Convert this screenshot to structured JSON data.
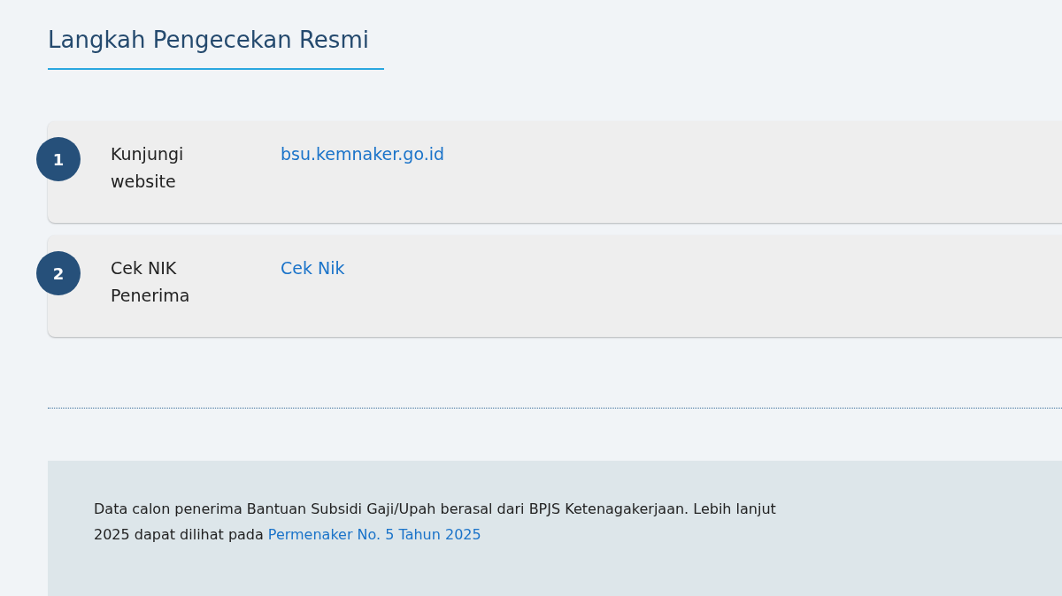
{
  "heading": "Langkah Pengecekan Resmi",
  "steps": [
    {
      "number": "1",
      "label": "Kunjungi website",
      "link": "bsu.kemnaker.go.id"
    },
    {
      "number": "2",
      "label": "Cek NIK Penerima",
      "link": "Cek Nik"
    }
  ],
  "note": {
    "line_1": "Data calon penerima Bantuan Subsidi Gaji/Upah berasal dari BPJS Ketenagakerjaan. Lebih lanjut",
    "line_2": "2025 dapat dilihat pada",
    "link": "Permenaker No. 5 Tahun 2025"
  }
}
